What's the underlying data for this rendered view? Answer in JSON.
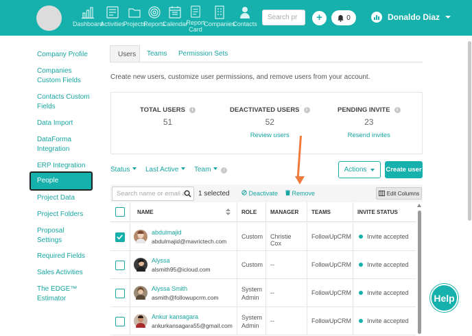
{
  "nav": {
    "items": [
      {
        "label": "Dashboard",
        "icon": "bar-chart-icon"
      },
      {
        "label": "Activities",
        "icon": "list-icon"
      },
      {
        "label": "Projects",
        "icon": "folder-icon"
      },
      {
        "label": "Reports",
        "icon": "target-icon"
      },
      {
        "label": "Calendar",
        "icon": "calendar-icon"
      },
      {
        "label": "Report Card",
        "icon": "report-card-icon"
      },
      {
        "label": "Companies",
        "icon": "building-icon"
      },
      {
        "label": "Contacts",
        "icon": "person-icon"
      }
    ],
    "search_placeholder": "Search pr",
    "add_label": "+",
    "notif_count": "0",
    "user_name": "Donaldo Diaz"
  },
  "sidebar": {
    "items": [
      {
        "label": "Company Profile"
      },
      {
        "label": "Companies Custom Fields"
      },
      {
        "label": "Contacts Custom Fields"
      },
      {
        "label": "Data Import"
      },
      {
        "label": "DataForma Integration"
      },
      {
        "label": "ERP Integration"
      },
      {
        "label": "People",
        "active": true
      },
      {
        "label": "Project Data"
      },
      {
        "label": "Project Folders"
      },
      {
        "label": "Proposal Settings"
      },
      {
        "label": "Required Fields"
      },
      {
        "label": "Sales Activities"
      },
      {
        "label": "The EDGE™ Estimator"
      }
    ]
  },
  "tabs": [
    {
      "label": "Users",
      "active": true
    },
    {
      "label": "Teams"
    },
    {
      "label": "Permission Sets"
    }
  ],
  "intro": "Create new users, customize user permissions, and remove users from your account.",
  "stats": {
    "total": {
      "label": "TOTAL USERS",
      "value": "51"
    },
    "deactivated": {
      "label": "DEACTIVATED USERS",
      "value": "52",
      "action": "Review users"
    },
    "pending": {
      "label": "PENDING INVITE",
      "value": "23",
      "action": "Resend invites"
    }
  },
  "filters": {
    "status": "Status",
    "last_active": "Last Active",
    "team": "Team",
    "actions": "Actions",
    "create_user": "Create user"
  },
  "toolbar": {
    "search_placeholder": "Search name or email a",
    "selected": "1 selected",
    "deactivate": "Deactivate",
    "remove": "Remove",
    "edit_columns": "Edit Columns"
  },
  "table": {
    "columns": [
      "NAME",
      "ROLE",
      "MANAGER",
      "TEAMS",
      "INVITE STATUS"
    ],
    "rows": [
      {
        "name": "abdulmajid",
        "email": "abdulmajid@mavrictech.com",
        "role": "Custom",
        "manager": "Christie Cox",
        "teams": "FollowUpCRM",
        "status": "Invite accepted",
        "checked": true
      },
      {
        "name": "Alyssa",
        "email": "alsmith95@icloud.com",
        "role": "Custom",
        "manager": "--",
        "teams": "FollowUpCRM",
        "status": "Invite accepted",
        "checked": false
      },
      {
        "name": "Alyssa Smith",
        "email": "asmith@followupcrm.com",
        "role": "System Admin",
        "manager": "--",
        "teams": "FollowUpCRM",
        "status": "Invite accepted",
        "checked": false
      },
      {
        "name": "Ankur kansagara",
        "email": "ankurkansagara55@gmail.com",
        "role": "System Admin",
        "manager": "--",
        "teams": "FollowUpCRM",
        "status": "Invite accepted",
        "checked": false
      }
    ]
  },
  "help_label": "Help",
  "colors": {
    "primary": "#16b1ac",
    "link": "#16a5a0",
    "annotation": "#f07b3c"
  }
}
